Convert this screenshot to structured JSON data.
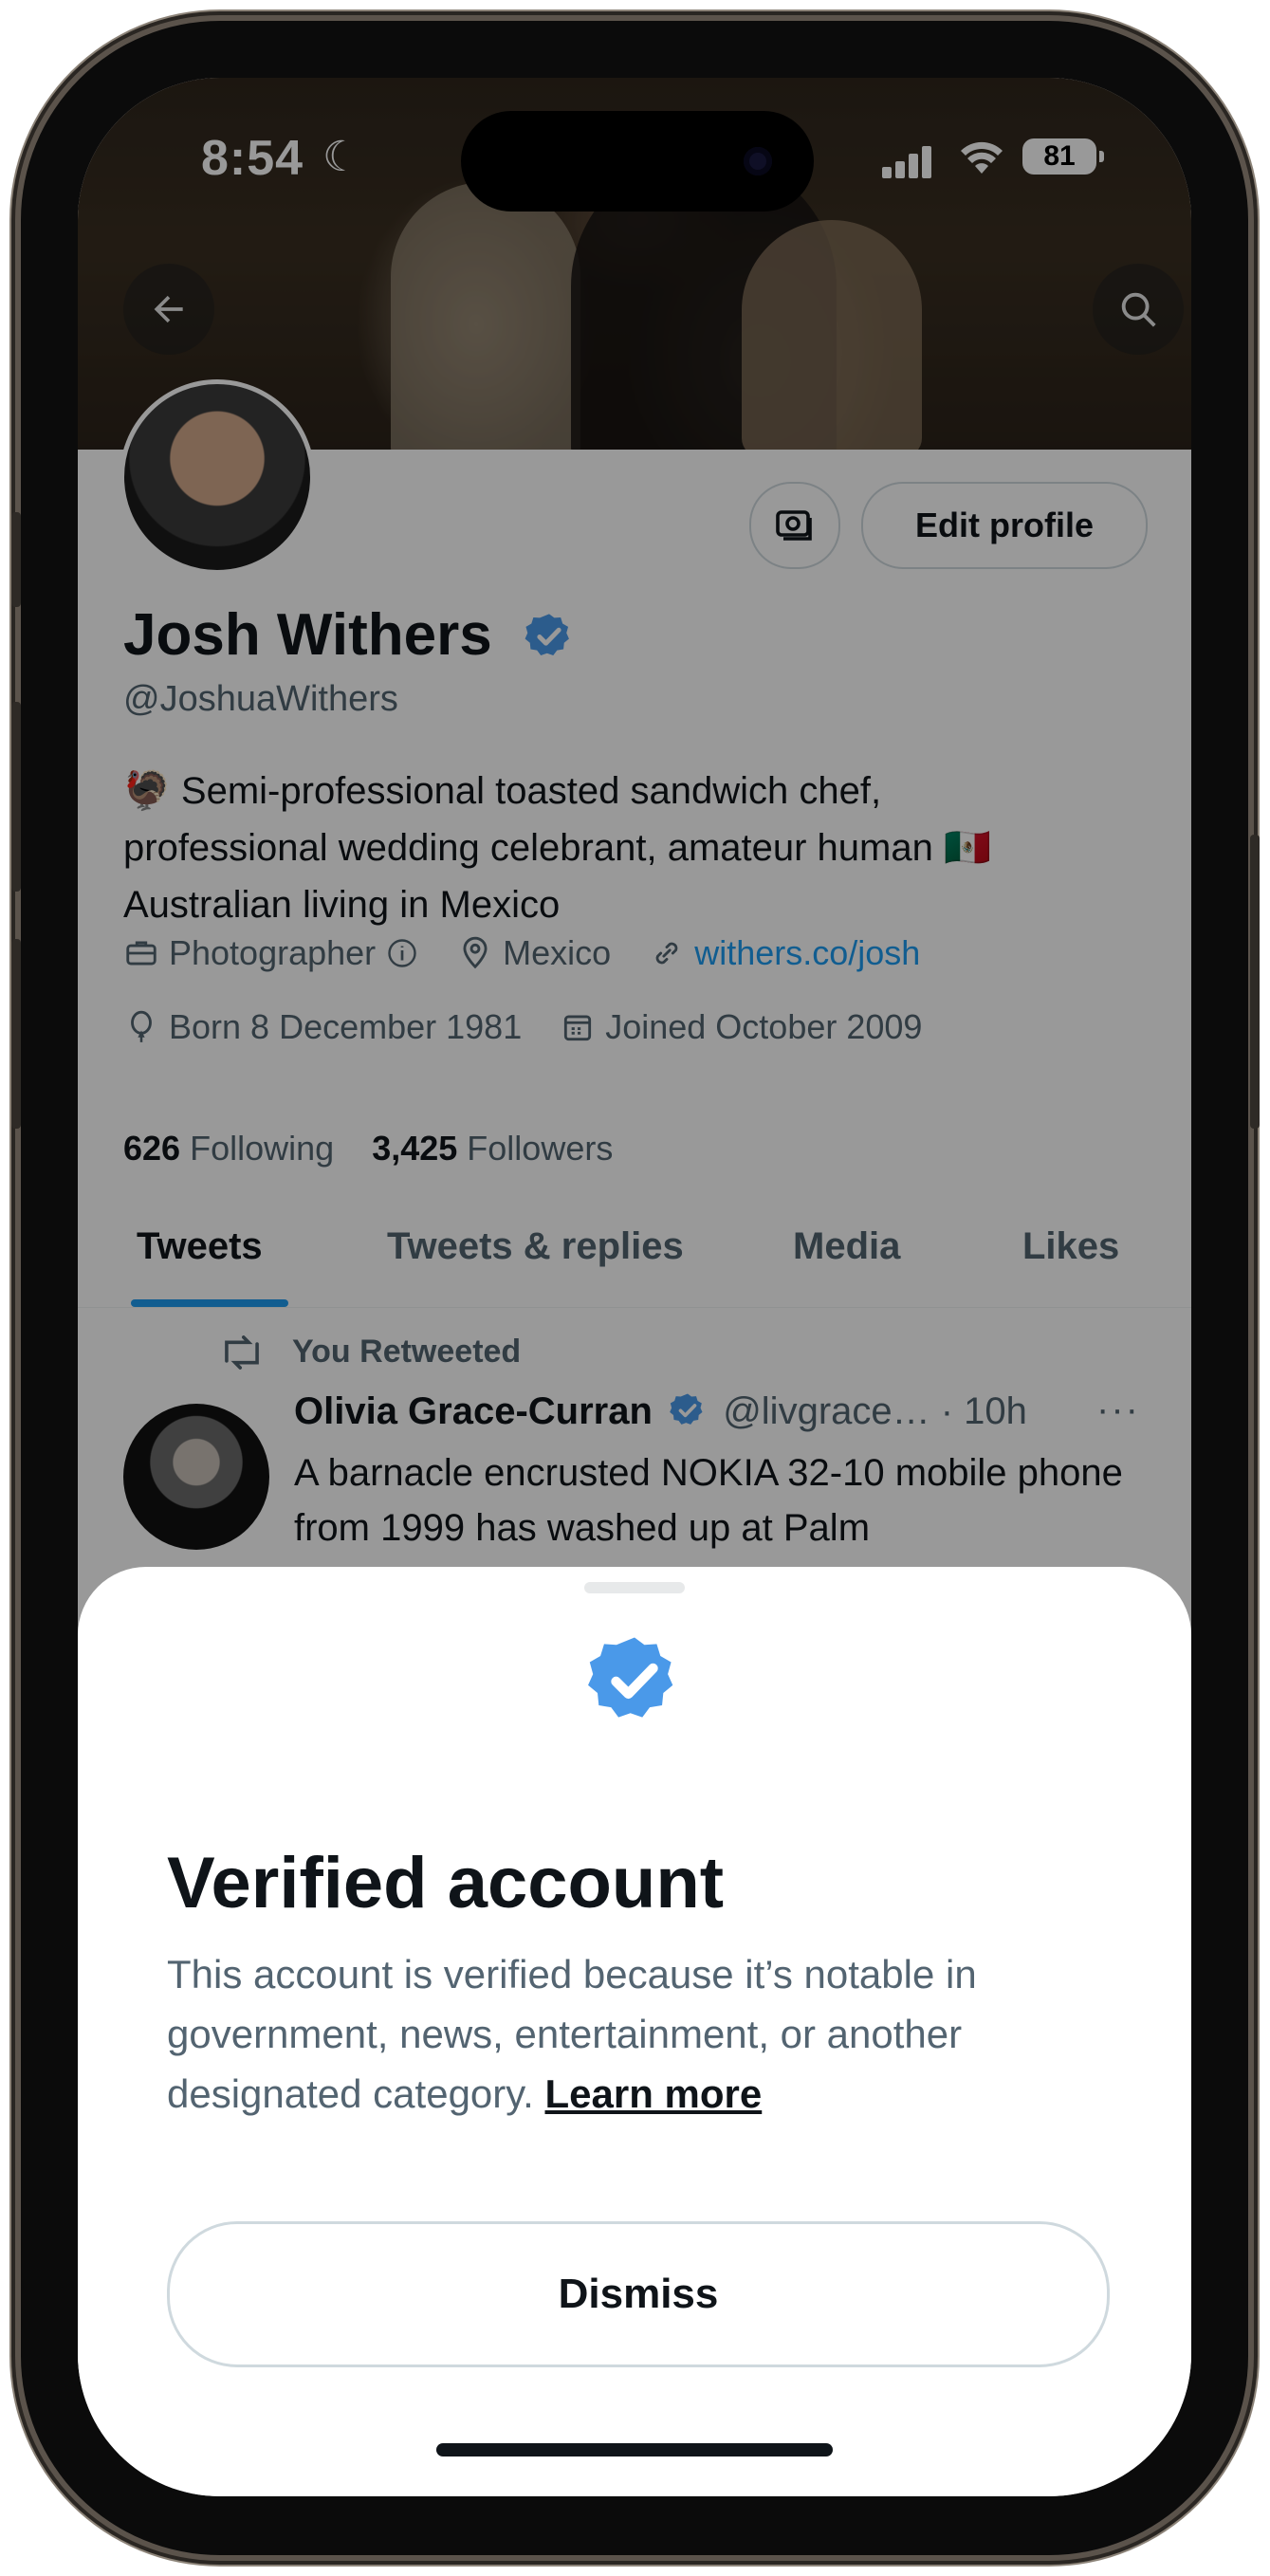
{
  "status_bar": {
    "time": "8:54",
    "battery": "81"
  },
  "profile": {
    "name": "Josh Withers",
    "handle": "@JoshuaWithers",
    "bio_line1": "🦃 Semi-professional toasted sandwich chef,",
    "bio_line2": "professional wedding celebrant, amateur human 🇲🇽",
    "bio_line3": "Australian living in Mexico",
    "category": "Photographer",
    "location": "Mexico",
    "website": "withers.co/josh",
    "birthday": "Born 8 December 1981",
    "joined": "Joined October 2009",
    "following_count": "626",
    "following_label": "Following",
    "followers_count": "3,425",
    "followers_label": "Followers",
    "edit_label": "Edit profile"
  },
  "tabs": [
    {
      "label": "Tweets"
    },
    {
      "label": "Tweets & replies"
    },
    {
      "label": "Media"
    },
    {
      "label": "Likes"
    }
  ],
  "tweet": {
    "retweet_label": "You Retweeted",
    "author": "Olivia Grace-Curran",
    "handle_time": "@livgrace… · 10h",
    "more": "···",
    "text": "A barnacle encrusted NOKIA 32-10 mobile phone from 1999 has washed up at Palm"
  },
  "sheet": {
    "title": "Verified account",
    "body": "This account is verified because it’s notable in government, news, entertainment, or another designated category.",
    "learn_more": "Learn more",
    "dismiss": "Dismiss"
  },
  "colors": {
    "accent": "#1d9bf0",
    "text": "#0f1419",
    "muted": "#536471",
    "verified": "#4a99e9"
  },
  "icons": [
    "back-arrow-icon",
    "search-icon",
    "camera-icon",
    "verified-badge-icon",
    "briefcase-icon",
    "info-icon",
    "location-pin-icon",
    "link-icon",
    "balloon-icon",
    "calendar-icon",
    "retweet-icon",
    "more-icon",
    "moon-icon",
    "signal-icon",
    "wifi-icon",
    "battery-icon"
  ]
}
